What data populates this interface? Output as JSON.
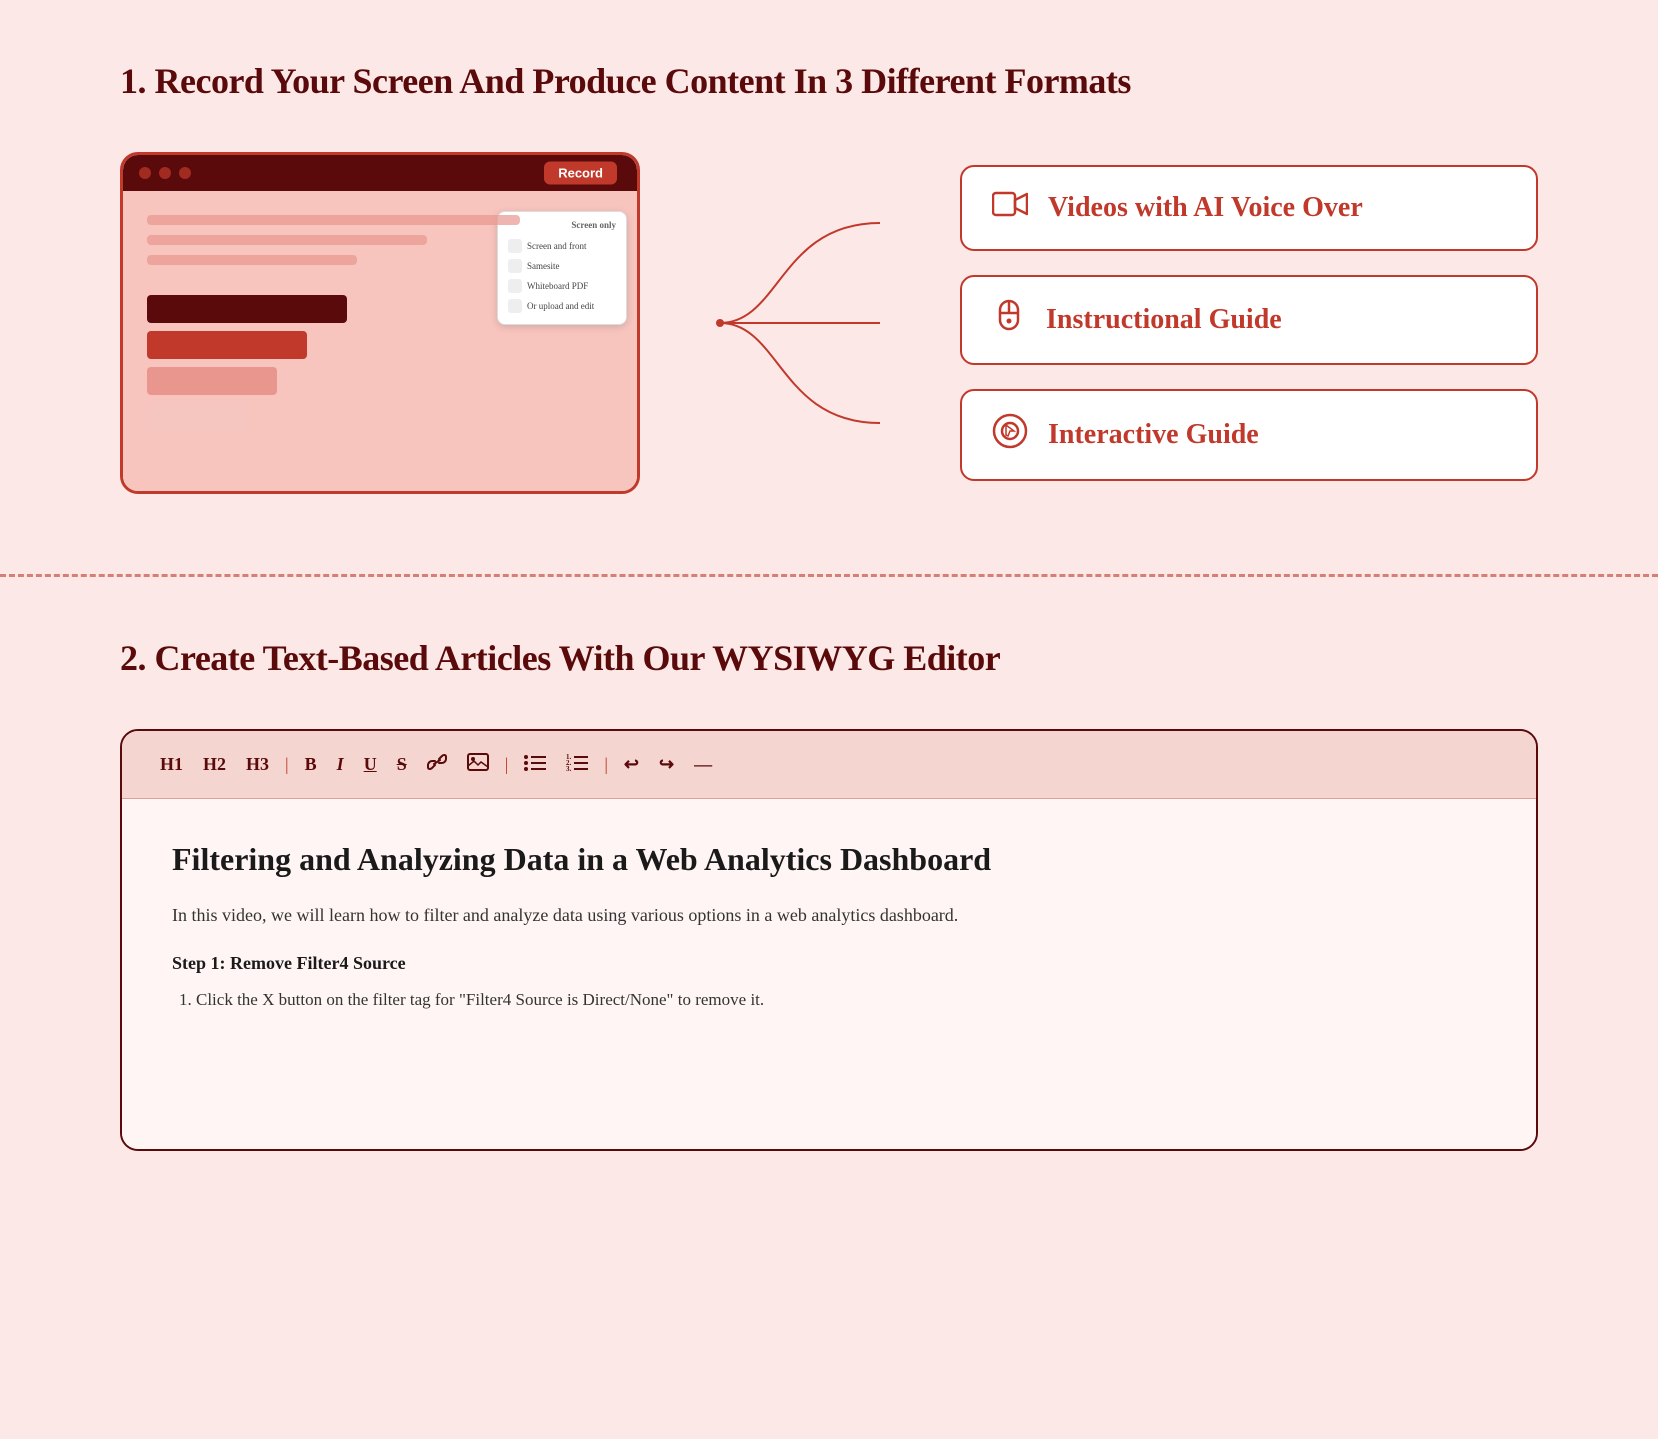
{
  "section1": {
    "title": "1.  Record Your Screen And Produce Content In 3 Different Formats",
    "screen": {
      "record_btn": "Record",
      "dropdown_header": "Screen only",
      "dropdown_items": [
        "Screen and front",
        "Samesite",
        "Whiteboard PDF",
        "Or upload and edit"
      ]
    },
    "output_cards": [
      {
        "id": "videos",
        "label": "Videos with AI Voice Over",
        "icon_name": "video-icon"
      },
      {
        "id": "instructional",
        "label": "Instructional Guide",
        "icon_name": "mouse-icon"
      },
      {
        "id": "interactive",
        "label": "Interactive Guide",
        "icon_name": "cursor-icon"
      }
    ]
  },
  "section2": {
    "title": "2.  Create Text-Based Articles With Our WYSIWYG Editor",
    "toolbar": {
      "buttons": [
        "H1",
        "H2",
        "H3",
        "B",
        "I",
        "U",
        "S",
        "⬡",
        "⎗",
        "|",
        "≡",
        "≣",
        "|",
        "↩",
        "↪",
        "—"
      ]
    },
    "article": {
      "title": "Filtering and Analyzing Data in a Web Analytics Dashboard",
      "intro": "In this video, we will learn how to filter and analyze data using various options in a web analytics dashboard.",
      "step1_title": "Step 1: Remove Filter4 Source",
      "step1_item": "Click the X button on the filter tag for \"Filter4 Source is Direct/None\" to remove it."
    }
  }
}
